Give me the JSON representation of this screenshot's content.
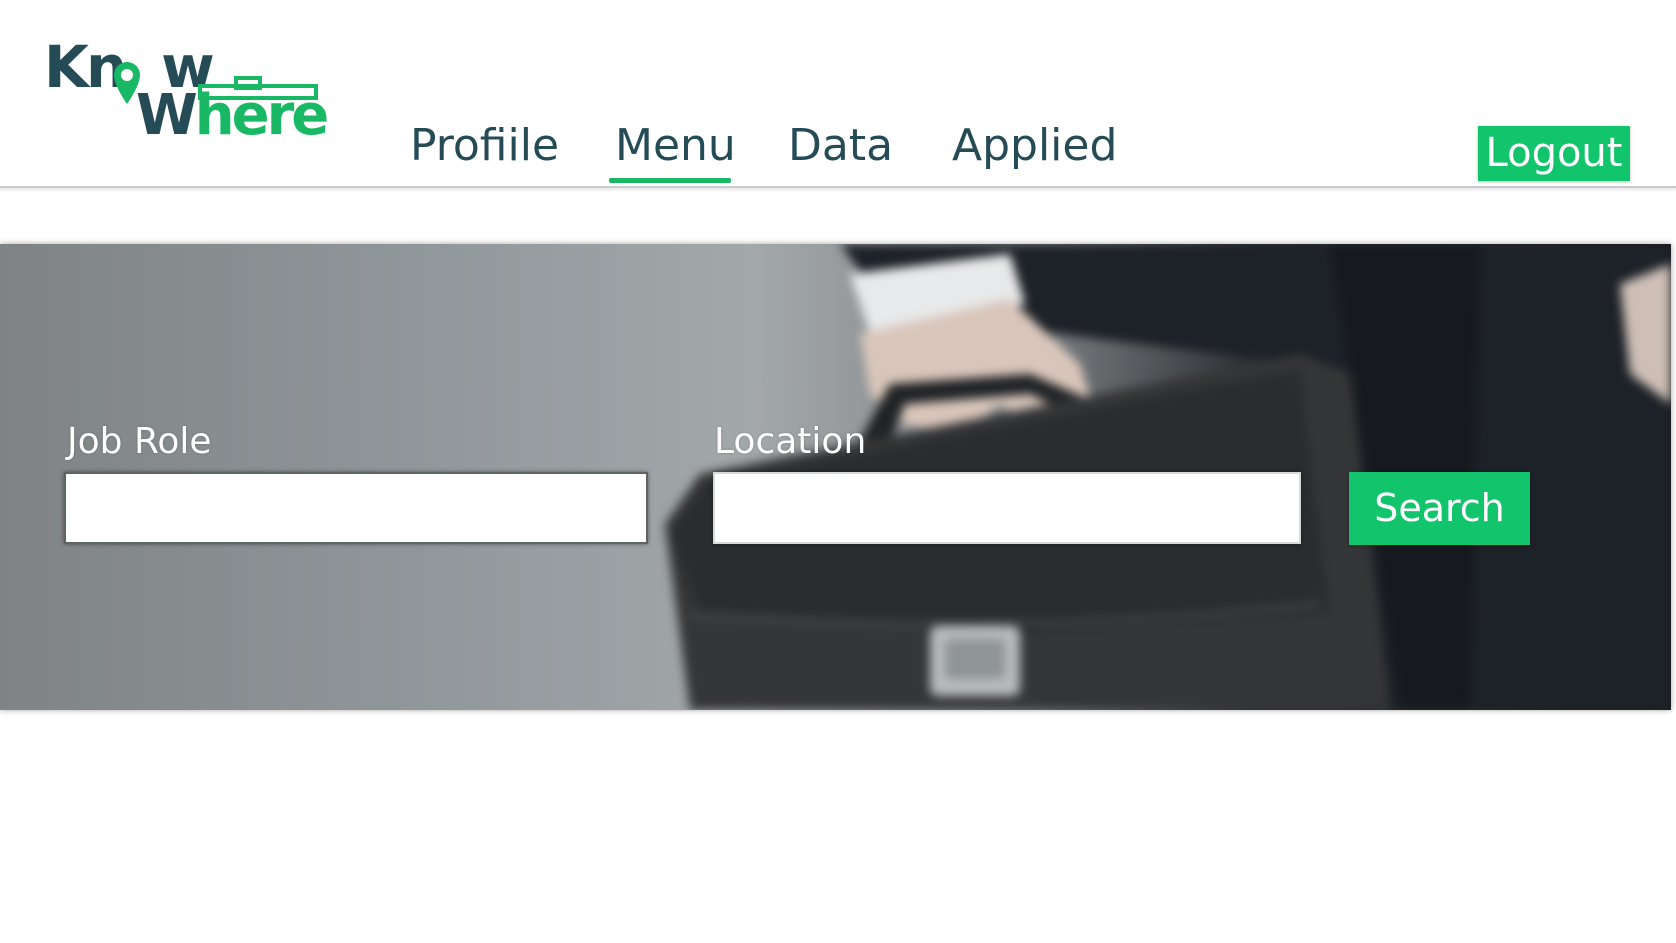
{
  "brand": {
    "logo_line1": "Know",
    "logo_line2_dark": "W",
    "logo_line2_green": "here",
    "dark_color": "#244b56",
    "accent_color": "#19b864"
  },
  "nav": {
    "items": [
      {
        "label": "Profiile"
      },
      {
        "label": "Menu",
        "active": true
      },
      {
        "label": "Data"
      },
      {
        "label": "Applied"
      }
    ],
    "logout_label": "Logout"
  },
  "search": {
    "job_role_label": "Job Role",
    "job_role_value": "",
    "location_label": "Location",
    "location_value": "",
    "button_label": "Search",
    "button_color": "#12c46b"
  },
  "hero": {
    "image": "businessman-holding-briefcase-photo"
  }
}
